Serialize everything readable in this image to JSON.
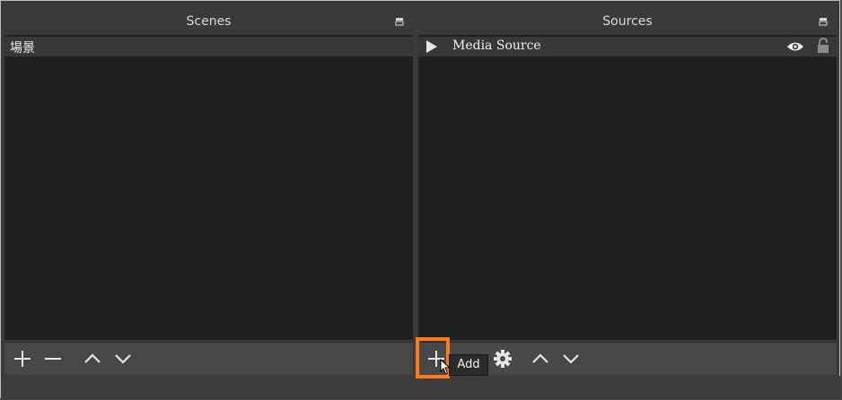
{
  "scenes": {
    "title": "Scenes",
    "items": [
      {
        "label": "場景"
      }
    ]
  },
  "sources": {
    "title": "Sources",
    "items": [
      {
        "label": "Media Source",
        "icon": "play-icon",
        "visible": true,
        "locked": true
      }
    ]
  },
  "tooltip": {
    "text": "Add"
  },
  "colors": {
    "highlight": "#ff7a1f",
    "panel_bg": "#202020",
    "row_bg": "#383838"
  }
}
